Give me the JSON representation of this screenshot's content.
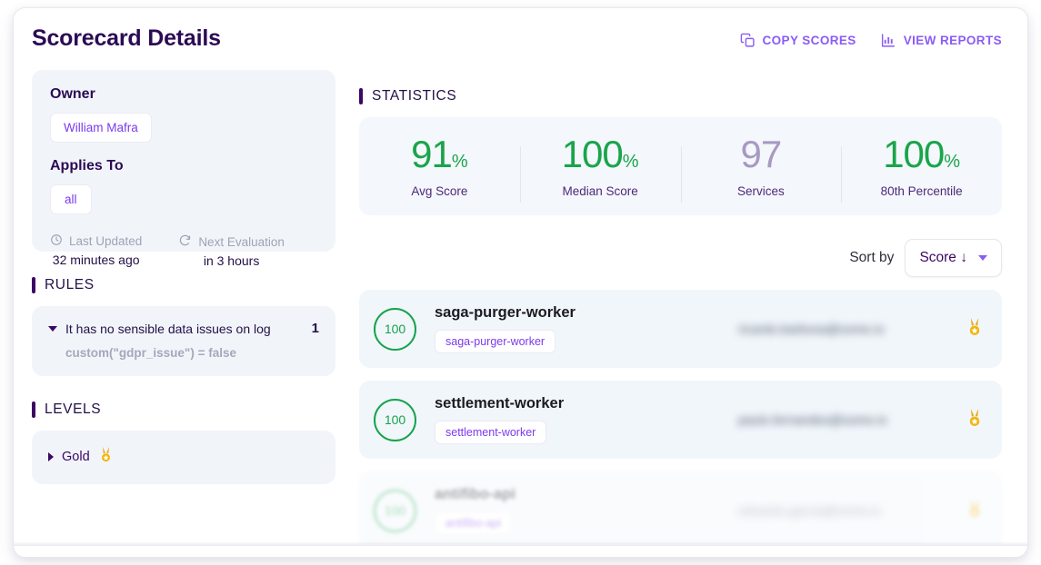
{
  "header": {
    "title": "Scorecard Details",
    "actions": [
      {
        "icon": "copy-icon",
        "label": "COPY SCORES"
      },
      {
        "icon": "bar-chart-icon",
        "label": "VIEW REPORTS"
      }
    ],
    "accent_color": "#8b5cf6",
    "title_color": "#2b0b54"
  },
  "sidebar": {
    "owner_card": {
      "owner_heading": "Owner",
      "owner_value": "William Mafra",
      "applies_to_heading": "Applies To",
      "applies_to_value": "all",
      "last_updated_label": "Last Updated",
      "last_updated_value": "32 minutes ago",
      "next_evaluation_label": "Next Evaluation",
      "next_evaluation_value": "in 3 hours"
    },
    "rules_section": {
      "title": "RULES",
      "rules": [
        {
          "name": "It has no sensible data issues on log",
          "count": "1",
          "expression": "custom(\"gdpr_issue\") = false"
        }
      ]
    },
    "levels_section": {
      "title": "LEVELS",
      "levels": [
        {
          "name": "Gold",
          "icon": "gold-medal-icon"
        }
      ]
    }
  },
  "main": {
    "statistics": {
      "title": "STATISTICS",
      "cells": [
        {
          "value": "91",
          "suffix": "%",
          "label": "Avg Score",
          "color": "#19a54a"
        },
        {
          "value": "100",
          "suffix": "%",
          "label": "Median Score",
          "color": "#19a54a"
        },
        {
          "value": "97",
          "suffix": "",
          "label": "Services",
          "color": "#a79ac2"
        },
        {
          "value": "100",
          "suffix": "%",
          "label": "80th Percentile",
          "color": "#19a54a"
        }
      ]
    },
    "sort": {
      "label": "Sort by",
      "value": "Score ↓"
    },
    "services": [
      {
        "score": "100",
        "name": "saga-purger-worker",
        "tag": "saga-purger-worker",
        "owner": "ricardo.barbosa@some.io",
        "medal": "gold-medal-icon",
        "faded": false
      },
      {
        "score": "100",
        "name": "settlement-worker",
        "tag": "settlement-worker",
        "owner": "paulo.fernandes@some.io",
        "medal": "gold-medal-icon",
        "faded": false
      },
      {
        "score": "100",
        "name": "antifibo-api",
        "tag": "antifibo-api",
        "owner": "eduardo.garcia@some.io",
        "medal": "gold-medal-icon",
        "faded": true
      }
    ]
  }
}
